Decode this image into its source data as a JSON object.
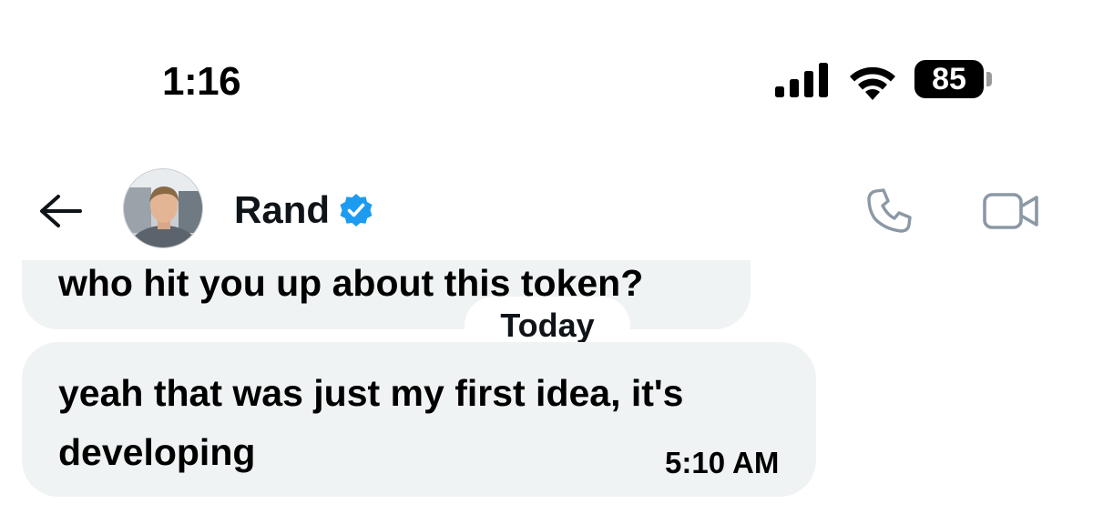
{
  "status_bar": {
    "time": "1:16",
    "battery_level": "85",
    "icons": [
      "cellular-signal-icon",
      "wifi-icon",
      "battery-icon"
    ]
  },
  "header": {
    "contact_name": "Rand",
    "verified": true,
    "icons": [
      "back-arrow-icon",
      "verified-badge-icon",
      "phone-call-icon",
      "video-call-icon"
    ],
    "accent_color": "#1d9bf0"
  },
  "conversation": {
    "messages": [
      {
        "text_lines": [
          "who hit you up about this token?"
        ],
        "time": ""
      },
      {
        "text_lines": [
          "yeah that was just my first idea, it's",
          "developing"
        ],
        "time": "5:10 AM"
      }
    ],
    "date_divider": "Today"
  },
  "colors": {
    "bubble": "#eff3f4",
    "text": "#0f1419",
    "icon_gray": "#8b98a5"
  }
}
